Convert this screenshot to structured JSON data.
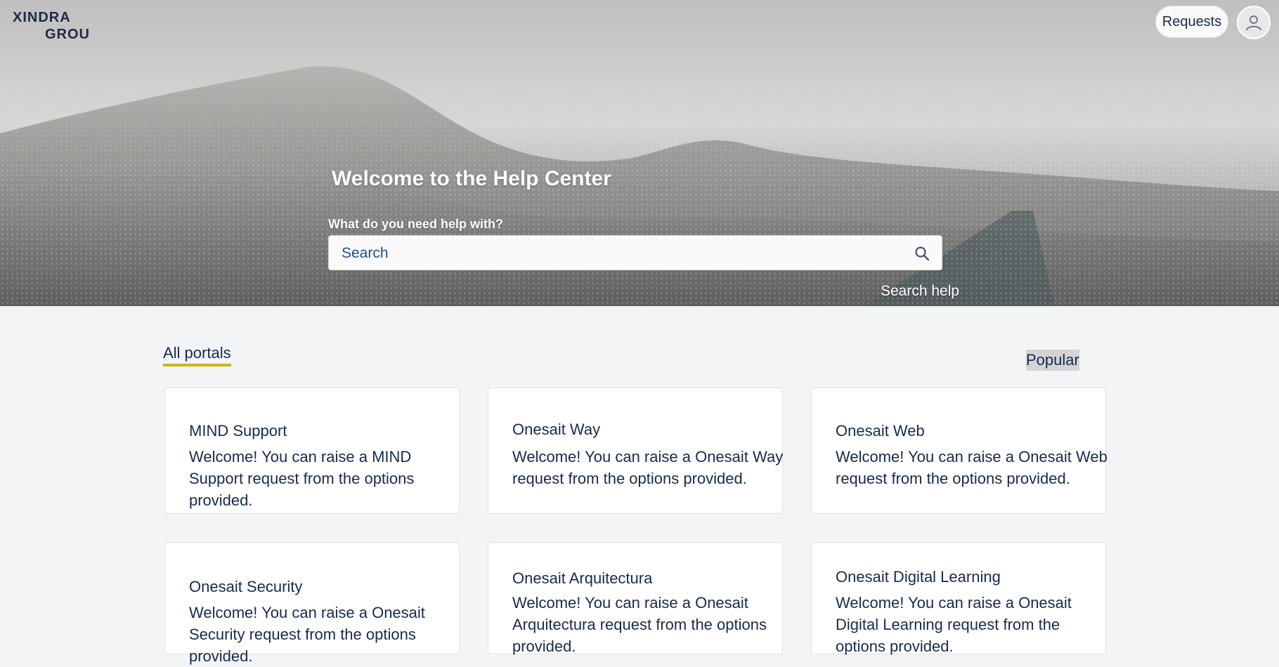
{
  "header": {
    "logo_line1": "XINDRA",
    "logo_line2": "GROU",
    "requests_label": "Requests",
    "avatar_icon": "user-icon"
  },
  "hero": {
    "title": "Welcome to the Help Center",
    "subtitle": "What do you need help with?",
    "search_placeholder": "Search",
    "search_icon": "search-icon",
    "search_help": "Search help"
  },
  "tabs": {
    "all_portals": "All portals",
    "popular": "Popular"
  },
  "portals": [
    {
      "title": "MIND Support",
      "description": "Welcome! You can raise a MIND Support request from the options provided."
    },
    {
      "title": "Onesait Way",
      "description": "Welcome! You can raise a Onesait Way request from the options provided."
    },
    {
      "title": "Onesait Web",
      "description": "Welcome! You can raise a Onesait Web request from the options provided."
    },
    {
      "title": "Onesait Security",
      "description": "Welcome! You can raise a Onesait Security request from the options provided."
    },
    {
      "title": "Onesait Arquitectura",
      "description": "Welcome! You can raise a Onesait Arquitectura request from the options provided."
    },
    {
      "title": "Onesait Digital Learning",
      "description": "Welcome! You can raise a Onesait Digital Learning request from the options provided."
    }
  ],
  "colors": {
    "accent": "#c9b716",
    "text": "#172b4d",
    "background": "#f3f4f6"
  }
}
